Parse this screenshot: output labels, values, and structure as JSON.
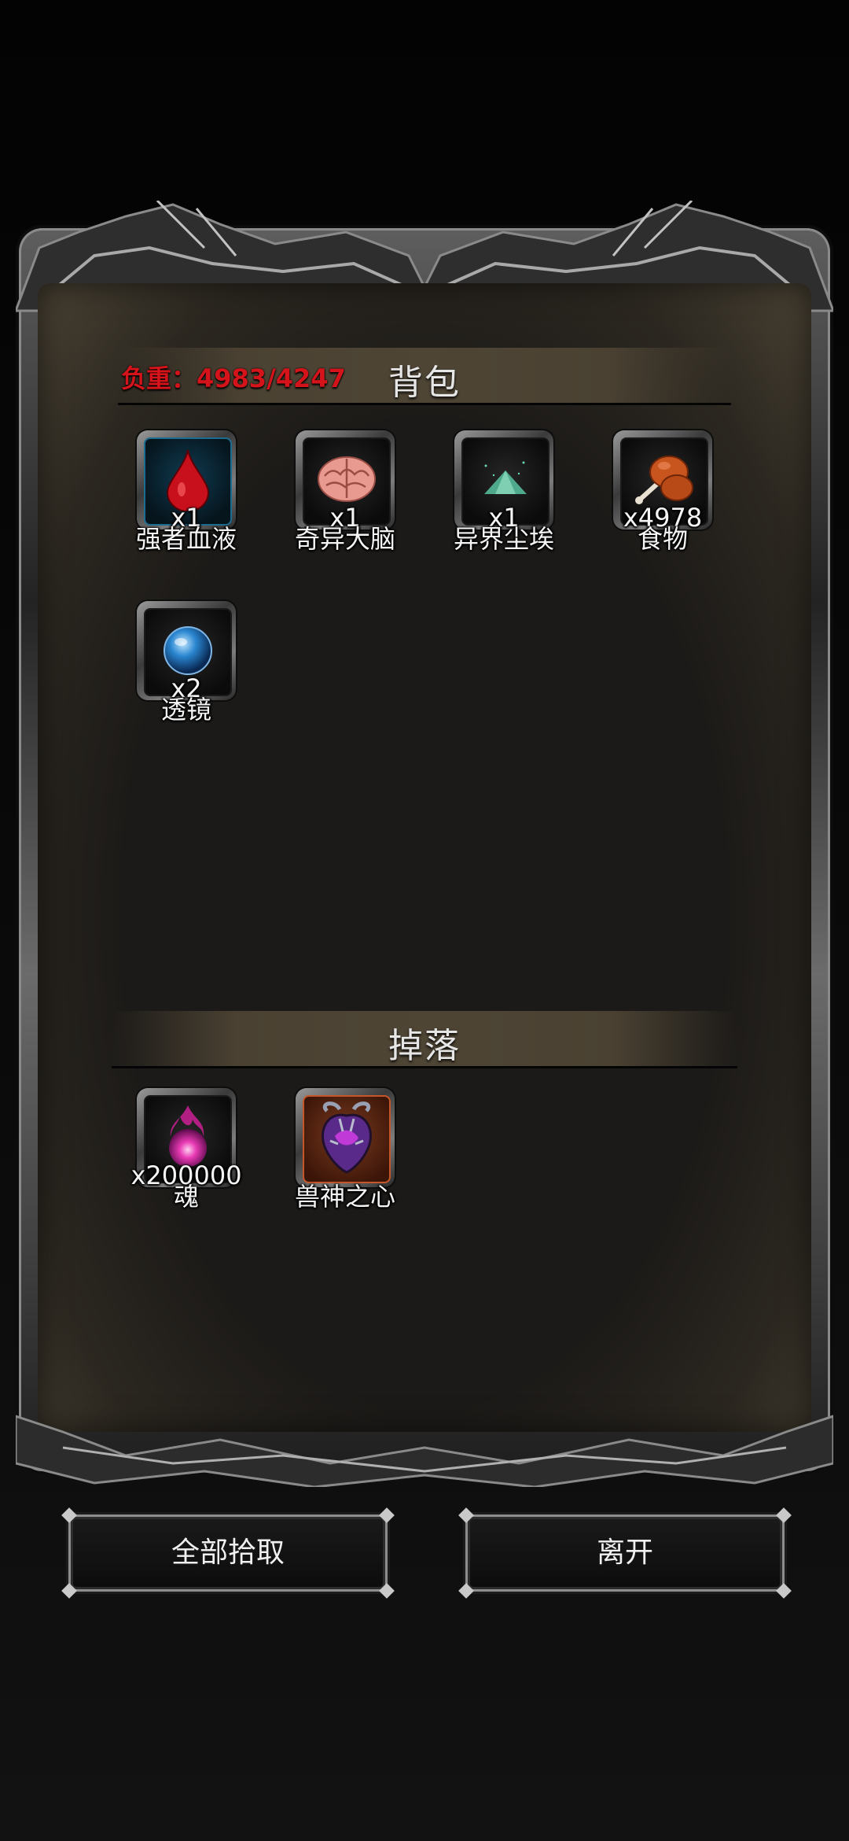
{
  "backpack": {
    "title": "背包",
    "weight_text": "负重：4983/4247",
    "items": [
      {
        "name": "强者血液",
        "qty": "x1",
        "icon": "blood-drop-icon"
      },
      {
        "name": "奇异大脑",
        "qty": "x1",
        "icon": "brain-icon"
      },
      {
        "name": "异界尘埃",
        "qty": "x1",
        "icon": "dust-pile-icon"
      },
      {
        "name": "食物",
        "qty": "x4978",
        "icon": "drumstick-icon"
      },
      {
        "name": "透镜",
        "qty": "x2",
        "icon": "lens-orb-icon"
      }
    ]
  },
  "drops": {
    "title": "掉落",
    "items": [
      {
        "name": "魂",
        "qty": "x200000",
        "icon": "soul-orb-icon"
      },
      {
        "name": "兽神之心",
        "qty": "",
        "icon": "beast-heart-icon"
      }
    ]
  },
  "buttons": {
    "pickup_all": "全部拾取",
    "leave": "离开"
  },
  "colors": {
    "weight_red": "#d4141a",
    "rare_border_blue": "#1d6c90",
    "epic_border_orange": "#c4562a"
  }
}
